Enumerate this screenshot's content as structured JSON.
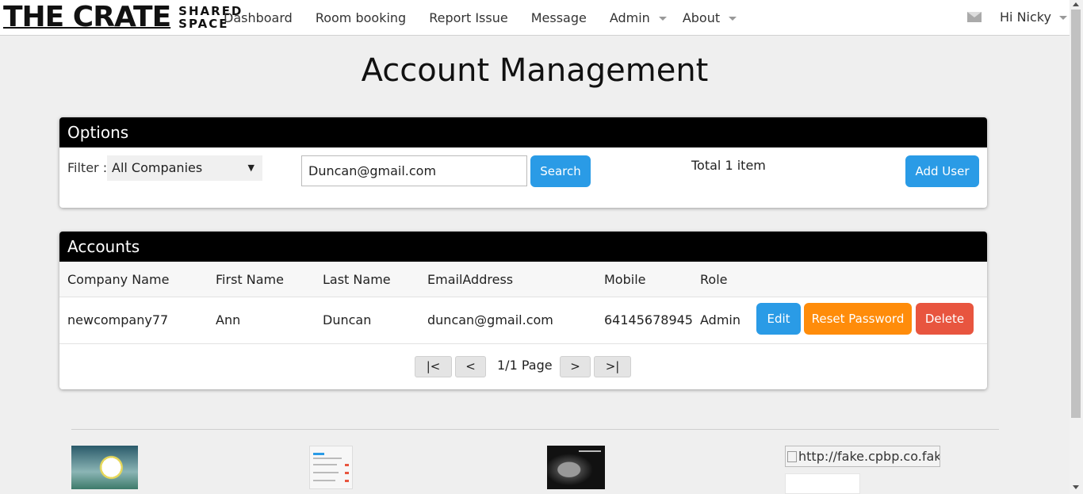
{
  "brand": {
    "name": "THE CRATE",
    "sub_line1": "SHARED",
    "sub_line2": "SPACE"
  },
  "nav": {
    "items": [
      "Dashboard",
      "Room booking",
      "Report Issue",
      "Message",
      "Admin",
      "About"
    ],
    "greeting": "Hi Nicky"
  },
  "page": {
    "title": "Account Management"
  },
  "options": {
    "heading": "Options",
    "filter_label": "Filter :",
    "filter_value": "All Companies",
    "filter_arrow": "▼",
    "search_value": "Duncan@gmail.com",
    "search_button": "Search",
    "total": "Total 1 item",
    "add_button": "Add User"
  },
  "accounts": {
    "heading": "Accounts",
    "columns": [
      "Company Name",
      "First Name",
      "Last Name",
      "EmailAddress",
      "Mobile",
      "Role"
    ],
    "rows": [
      {
        "company": "newcompany77",
        "first": "Ann",
        "last": "Duncan",
        "email": "duncan@gmail.com",
        "mobile": "64145678945",
        "role": "Admin"
      }
    ],
    "actions": {
      "edit": "Edit",
      "reset": "Reset Password",
      "delete": "Delete"
    },
    "pager": {
      "first": "|<",
      "prev": "<",
      "page": "1/1 Page",
      "next": ">",
      "last": ">|"
    }
  },
  "footer": {
    "broken_image_alt": "http://fake.cpbp.co.fake"
  },
  "colors": {
    "primary": "#2a9be6",
    "warning": "#ff8c0a",
    "danger": "#e8553f",
    "panel_header": "#000000"
  }
}
